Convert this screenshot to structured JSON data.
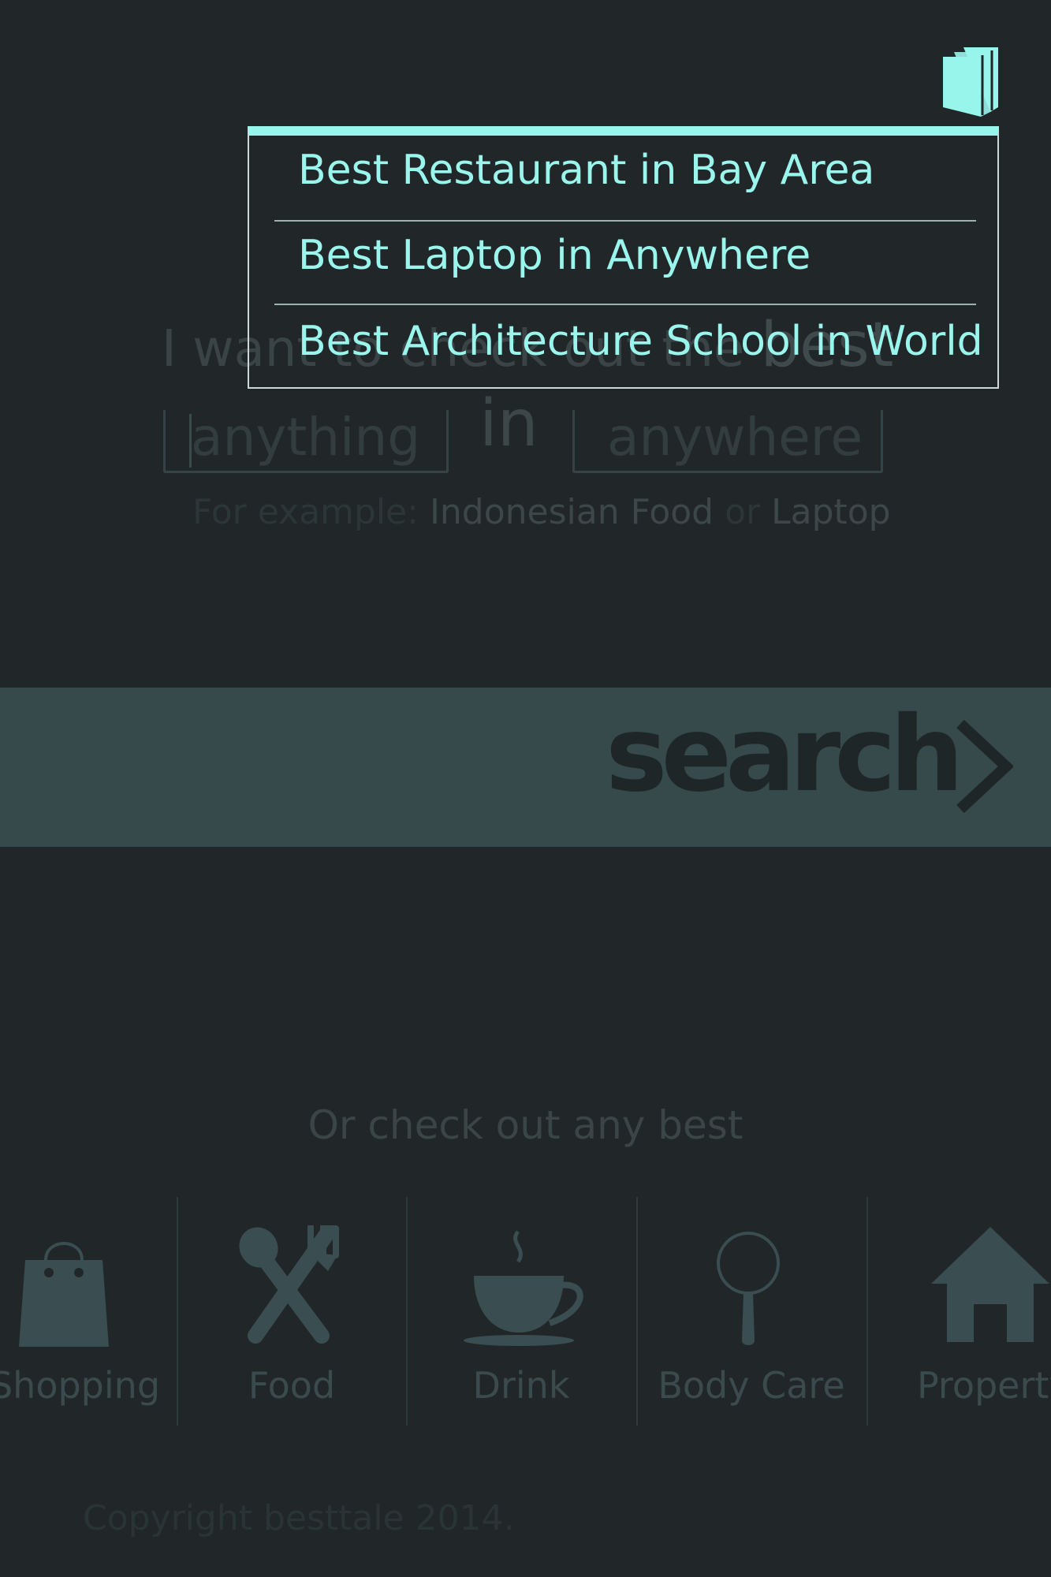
{
  "hero": {
    "prefix": "I want to check out the ",
    "best": "best",
    "anything_placeholder": "anything",
    "in_word": "in",
    "anywhere_placeholder": "anywhere",
    "example_prefix": "For example: ",
    "example_a": "Indonesian Food",
    "example_or": " or ",
    "example_b": "Laptop"
  },
  "search": {
    "label": "search"
  },
  "dropdown": {
    "items": [
      "Best Restaurant in Bay Area",
      "Best Laptop in Anywhere",
      "Best Architecture School in World"
    ]
  },
  "categories": {
    "heading": "Or check out any best",
    "items": [
      {
        "label": "Shopping",
        "icon": "shopping-bag-icon"
      },
      {
        "label": "Food",
        "icon": "fork-spoon-icon"
      },
      {
        "label": "Drink",
        "icon": "coffee-cup-icon"
      },
      {
        "label": "Body Care",
        "icon": "mirror-icon"
      },
      {
        "label": "Property",
        "icon": "house-icon"
      }
    ]
  },
  "footer": {
    "copyright": "Copyright besttale 2014."
  },
  "colors": {
    "background": "#212729",
    "accent": "#98f5ec",
    "search_bar": "#364a4c",
    "icon": "#3a4d50"
  }
}
